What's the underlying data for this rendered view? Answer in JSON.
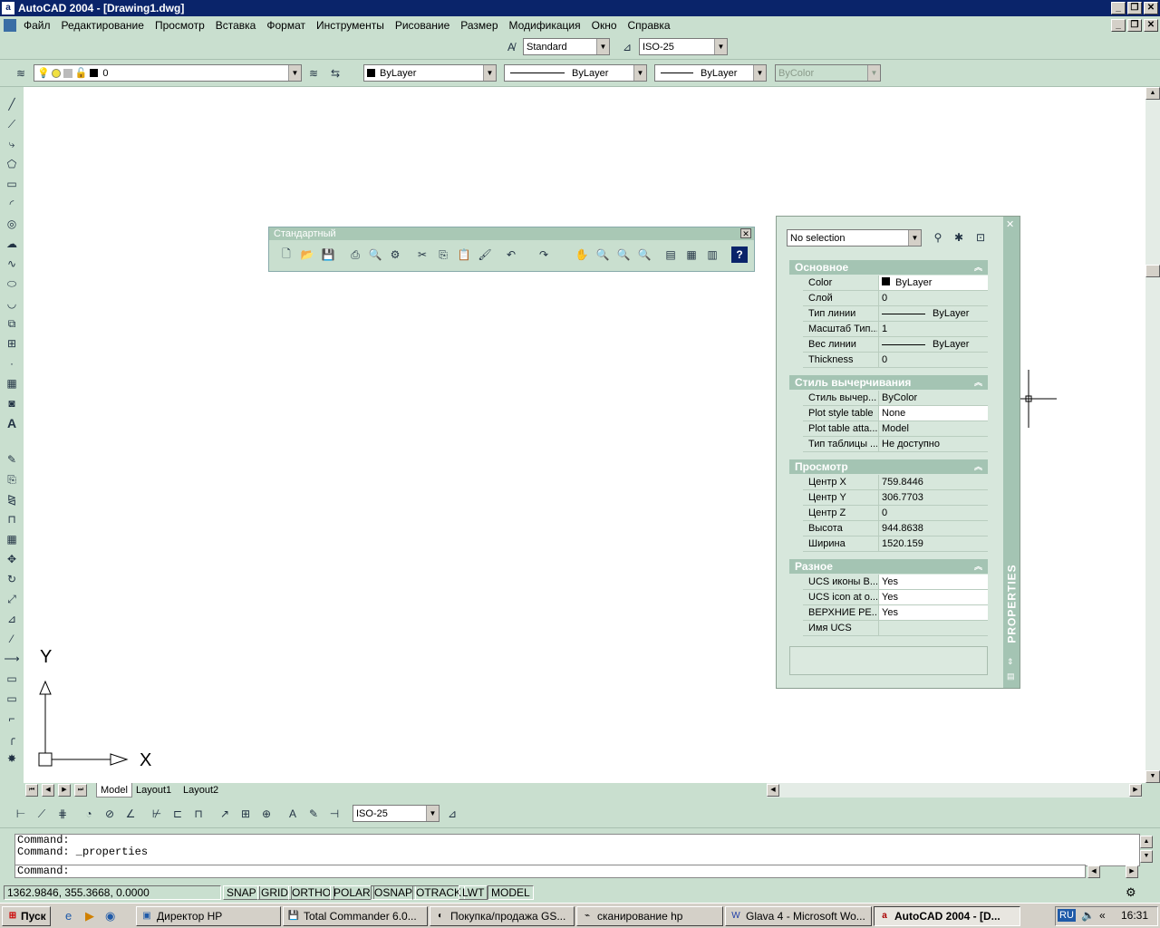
{
  "window": {
    "title": "AutoCAD 2004 - [Drawing1.dwg]",
    "app_icon": "autocad-icon"
  },
  "menu": [
    "Файл",
    "Редактирование",
    "Просмотр",
    "Вставка",
    "Формат",
    "Инструменты",
    "Рисование",
    "Размер",
    "Модификация",
    "Окно",
    "Справка"
  ],
  "styles_toolbar": {
    "text_style": "Standard",
    "dim_style": "ISO-25"
  },
  "layers_toolbar": {
    "layer": "0",
    "color": "ByLayer",
    "linetype": "ByLayer",
    "lineweight": "ByLayer",
    "plotstyle": "ByColor"
  },
  "std_toolbar": {
    "title": "Стандартный"
  },
  "ucs": {
    "x_label": "X",
    "y_label": "Y"
  },
  "tabs": [
    "Model",
    "Layout1",
    "Layout2"
  ],
  "properties": {
    "selection": "No selection",
    "side_title": "PROPERTIES",
    "sections": [
      {
        "title": "Основное",
        "rows": [
          [
            "Color",
            "ByLayer"
          ],
          [
            "Слой",
            "0"
          ],
          [
            "Тип линии",
            "ByLayer"
          ],
          [
            "Масштаб Тип...",
            "1"
          ],
          [
            "Вес линии",
            "ByLayer"
          ],
          [
            "Thickness",
            "0"
          ]
        ]
      },
      {
        "title": "Стиль вычерчивания",
        "rows": [
          [
            "Стиль вычер...",
            "ByColor"
          ],
          [
            "Plot style table",
            "None"
          ],
          [
            "Plot table atta...",
            "Model"
          ],
          [
            "Тип таблицы ...",
            "Не доступно"
          ]
        ]
      },
      {
        "title": "Просмотр",
        "rows": [
          [
            "Центр X",
            "759.8446"
          ],
          [
            "Центр Y",
            "306.7703"
          ],
          [
            "Центр Z",
            "0"
          ],
          [
            "Высота",
            "944.8638"
          ],
          [
            "Ширина",
            "1520.159"
          ]
        ]
      },
      {
        "title": "Разное",
        "rows": [
          [
            "UCS иконы В...",
            "Yes"
          ],
          [
            "UCS icon at o...",
            "Yes"
          ],
          [
            "ВЕРХНИЕ РЕ...",
            "Yes"
          ],
          [
            "Имя UCS",
            ""
          ]
        ]
      }
    ]
  },
  "dim_toolbar": {
    "dim_style": "ISO-25"
  },
  "command": {
    "line1": "Command:",
    "line2": "Command:  _properties",
    "prompt": "Command:"
  },
  "status": {
    "coords": "1362.9846, 355.3668, 0.0000",
    "buttons": [
      "SNAP",
      "GRID",
      "ORTHO",
      "POLAR",
      "OSNAP",
      "OTRACK",
      "LWT",
      "MODEL"
    ]
  },
  "taskbar": {
    "start": "Пуск",
    "tasks": [
      "Директор HP",
      "Total Commander 6.0...",
      "Покупка/продажа GS...",
      "сканирование hp",
      "Glava 4 - Microsoft Wo...",
      "AutoCAD 2004 - [D..."
    ],
    "lang": "RU",
    "time": "16:31"
  }
}
